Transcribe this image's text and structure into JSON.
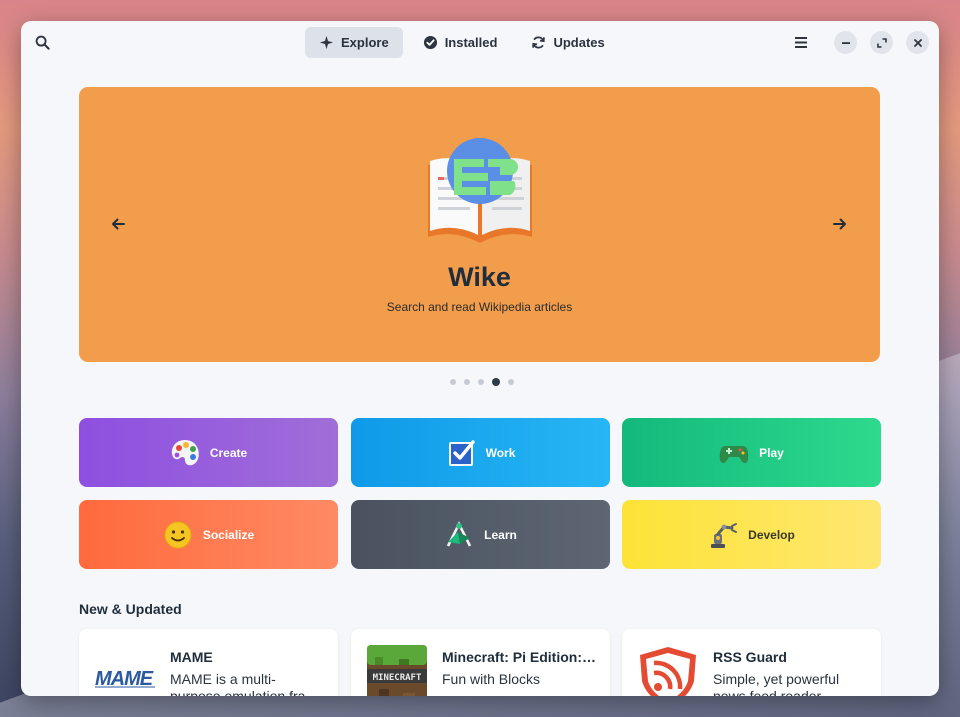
{
  "header": {
    "tabs": [
      {
        "label": "Explore",
        "icon": "explore-icon",
        "active": true
      },
      {
        "label": "Installed",
        "icon": "installed-check-icon",
        "active": false
      },
      {
        "label": "Updates",
        "icon": "updates-refresh-icon",
        "active": false
      }
    ],
    "icons": [
      "search-icon",
      "hamburger-menu-icon",
      "minimize-icon",
      "maximize-icon",
      "close-icon"
    ]
  },
  "featured": {
    "title": "Wike",
    "subtitle": "Search and read Wikipedia articles",
    "background": "#f29d4b",
    "carousel_total": 5,
    "carousel_active": 4
  },
  "categories": [
    {
      "label": "Create",
      "icon": "palette-icon"
    },
    {
      "label": "Work",
      "icon": "checkbox-icon"
    },
    {
      "label": "Play",
      "icon": "gamepad-icon"
    },
    {
      "label": "Socialize",
      "icon": "smiley-icon"
    },
    {
      "label": "Learn",
      "icon": "compass-icon"
    },
    {
      "label": "Develop",
      "icon": "robot-arm-icon"
    }
  ],
  "new_updated": {
    "title": "New & Updated",
    "apps": [
      {
        "name": "MAME",
        "description": "MAME is a multi-purpose emulation fra",
        "icon": "mame-logo-icon"
      },
      {
        "name": "Minecraft: Pi Edition:…",
        "description": "Fun with Blocks",
        "icon": "minecraft-icon"
      },
      {
        "name": "RSS Guard",
        "description": "Simple, yet powerful news feed reader",
        "icon": "rss-shield-icon"
      }
    ]
  }
}
